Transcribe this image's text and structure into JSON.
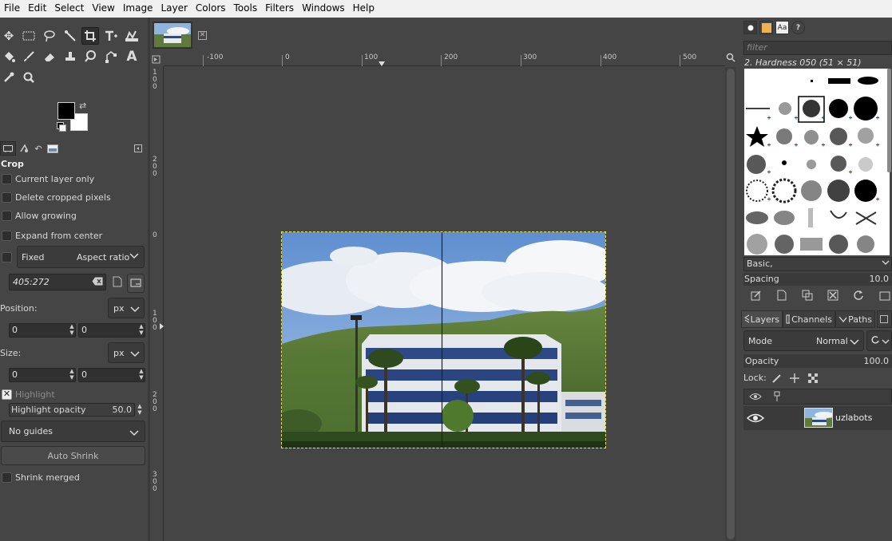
{
  "menubar": {
    "items": [
      "File",
      "Edit",
      "Select",
      "View",
      "Image",
      "Layer",
      "Colors",
      "Tools",
      "Filters",
      "Windows",
      "Help"
    ]
  },
  "toolbox": {
    "tool_icons": [
      "move-tool-icon",
      "rect-select-icon",
      "lasso-icon",
      "fuzzy-select-icon",
      "crop-tool-icon",
      "transform-tool-icon",
      "warp-tool-icon",
      "bucket-fill-icon",
      "paintbrush-icon",
      "eraser-icon",
      "clone-icon",
      "smudge-icon",
      "path-tool-icon",
      "text-tool-icon",
      "color-picker-icon",
      "zoom-tool-icon"
    ],
    "tool_options": {
      "title": "Crop",
      "current_layer_only": "Current layer only",
      "delete_cropped_pixels": "Delete cropped pixels",
      "allow_growing": "Allow growing",
      "expand_from_center": "Expand from center",
      "fixed_label": "Fixed",
      "aspect_ratio_label": "Aspect ratio",
      "ratio_value": "405:272",
      "position_label": "Position:",
      "position_unit": "px",
      "position_x": "0",
      "position_y": "0",
      "size_label": "Size:",
      "size_unit": "px",
      "size_w": "0",
      "size_h": "0",
      "highlight_label": "Highlight",
      "highlight_opacity_label": "Highlight opacity",
      "highlight_opacity_value": "50.0",
      "guides_value": "No guides",
      "auto_shrink_label": "Auto Shrink",
      "shrink_merged_label": "Shrink merged"
    }
  },
  "rulers": {
    "horizontal": [
      "-100",
      "0",
      "100",
      "200",
      "300",
      "400",
      "500"
    ],
    "vertical": [
      "100",
      "200",
      "0",
      "100",
      "200",
      "300"
    ]
  },
  "right_dock": {
    "filter_placeholder": "filter",
    "brush_name": "2. Hardness 050 (51 × 51)",
    "preset": "Basic,",
    "spacing_label": "Spacing",
    "spacing_value": "10.0",
    "tabs": {
      "layers": "Layers",
      "channels": "Channels",
      "paths": "Paths"
    },
    "mode_label": "Mode",
    "mode_value": "Normal",
    "opacity_label": "Opacity",
    "opacity_value": "100.0",
    "lock_label": "Lock:",
    "layer_name": "uzlabots"
  },
  "colors": {
    "accent_selected": "#2f2f2f",
    "selection_marching_ants": "#e8e84a",
    "background": "#454545"
  }
}
